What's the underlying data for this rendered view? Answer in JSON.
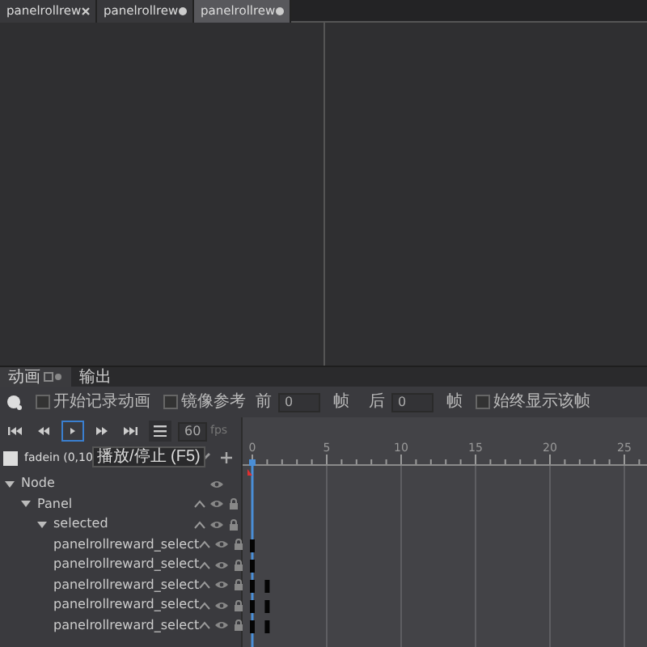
{
  "doc_tabs": [
    {
      "label": "panelrollrew",
      "kind": "closable",
      "selected": false
    },
    {
      "label": "panelrollrew",
      "kind": "modified",
      "selected": false
    },
    {
      "label": "panelrollrew",
      "kind": "modified",
      "selected": true
    }
  ],
  "panel_tabs": [
    {
      "label": "动画",
      "selected": true
    },
    {
      "label": "输出",
      "selected": false
    }
  ],
  "options": {
    "record": {
      "label": "开始记录动画",
      "checked": false
    },
    "mirror": {
      "label": "镜像参考",
      "checked": false
    },
    "before_label": "前",
    "before_value": "0",
    "before_unit": "帧",
    "after_label": "后",
    "after_value": "0",
    "after_unit": "帧",
    "always": {
      "label": "始终显示该帧",
      "checked": false
    }
  },
  "transport": {
    "buttons": [
      {
        "kind": "first",
        "selected": false
      },
      {
        "kind": "prev",
        "selected": false
      },
      {
        "kind": "play",
        "selected": true
      },
      {
        "kind": "next",
        "selected": false
      },
      {
        "kind": "last",
        "selected": false
      }
    ],
    "fps": "60",
    "fps_unit": "fps"
  },
  "clip": {
    "name": "fadein (0,10",
    "tooltip": "播放/停止 (F5)"
  },
  "ruler": [
    "0",
    "5",
    "10",
    "15",
    "20",
    "25"
  ],
  "tree": [
    {
      "label": "Node",
      "expanded": true,
      "children": [
        {
          "label": "Panel",
          "expanded": true,
          "children": [
            {
              "label": "selected",
              "expanded": true,
              "children": [
                {
                  "label": "panelrollreward_select",
                  "key_frame_0": true,
                  "key_frame_1": false
                },
                {
                  "label": "panelrollreward_select",
                  "key_frame_0": true,
                  "key_frame_1": false
                },
                {
                  "label": "panelrollreward_select",
                  "key_frame_0": true,
                  "key_frame_1": true
                },
                {
                  "label": "panelrollreward_select",
                  "key_frame_0": true,
                  "key_frame_1": true
                },
                {
                  "label": "panelrollreward_select",
                  "key_frame_0": true,
                  "key_frame_1": true
                }
              ]
            }
          ]
        }
      ]
    }
  ]
}
